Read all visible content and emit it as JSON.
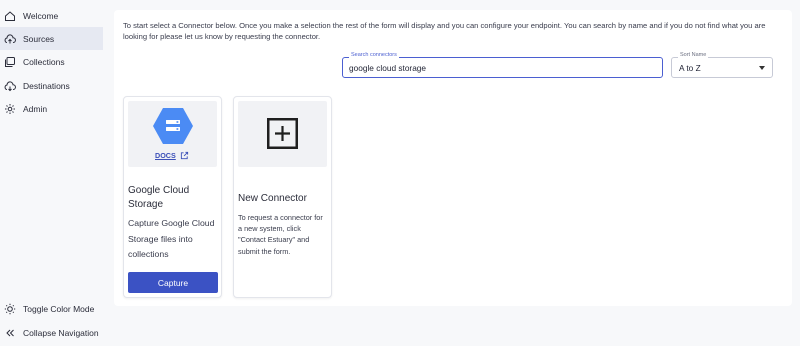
{
  "sidebar": {
    "items": [
      {
        "label": "Welcome",
        "icon": "home-icon"
      },
      {
        "label": "Sources",
        "icon": "cloud-upload-icon"
      },
      {
        "label": "Collections",
        "icon": "collections-icon"
      },
      {
        "label": "Destinations",
        "icon": "cloud-download-icon"
      },
      {
        "label": "Admin",
        "icon": "gear-icon"
      }
    ],
    "active_item": "Sources",
    "bottom": {
      "toggle_color_mode": "Toggle Color Mode",
      "collapse_navigation": "Collapse Navigation"
    }
  },
  "main": {
    "intro": "To start select a Connector below. Once you make a selection the rest of the form will display and you can configure your endpoint. You can search by name and if you do not find what you are looking for please let us know by requesting the connector.",
    "search": {
      "label": "Search connectors",
      "value": "google cloud storage"
    },
    "sort": {
      "label": "Sort Name",
      "value": "A to Z"
    },
    "cards": [
      {
        "title": "Google Cloud Storage",
        "description": "Capture Google Cloud Storage files into collections",
        "docs_label": "DOCS",
        "button_label": "Capture",
        "logo": "google-cloud-storage-logo"
      },
      {
        "title": "New Connector",
        "description": "To request a connector for a new system, click \"Contact Estuary\" and submit the form.",
        "logo": "plus-square-icon"
      }
    ]
  },
  "colors": {
    "accent": "#3b52c4",
    "focus": "#4b5fd1",
    "gcs_blue": "#4b8bf4",
    "active_nav": "#e6e9f2"
  }
}
